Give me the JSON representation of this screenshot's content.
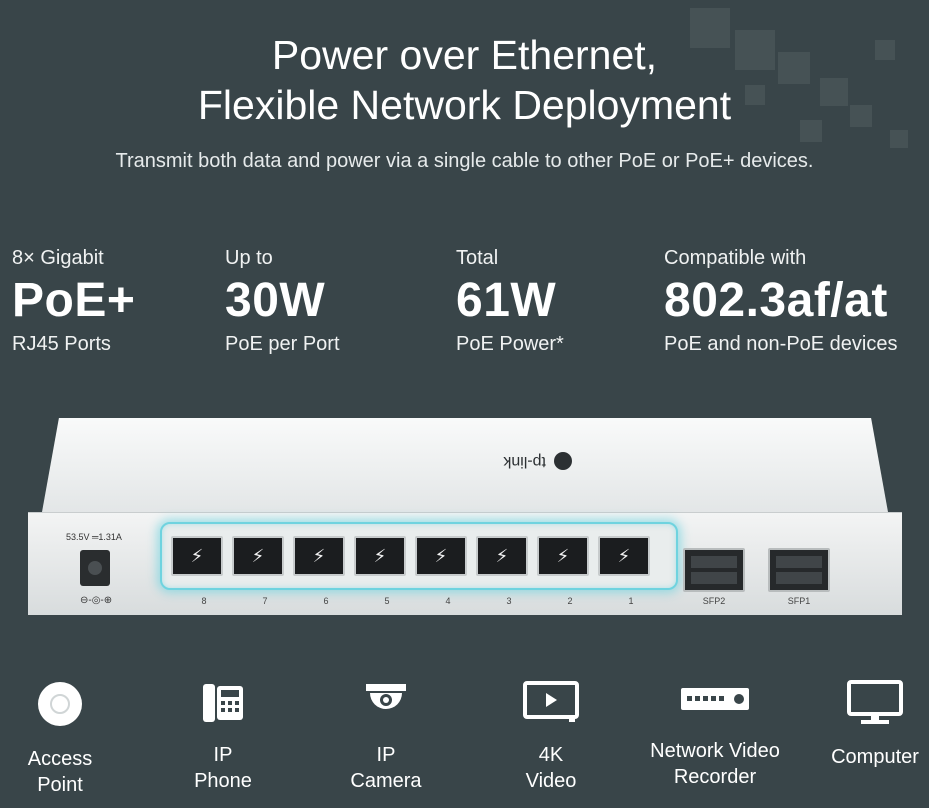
{
  "headline": {
    "line1": "Power over Ethernet,",
    "line2": "Flexible Network Deployment"
  },
  "subheadline": "Transmit both data and power via a single cable to other PoE or PoE+ devices.",
  "specs": [
    {
      "top": "8× Gigabit",
      "value": "PoE+",
      "bottom": "RJ45 Ports"
    },
    {
      "top": "Up to",
      "value": "30W",
      "bottom": "PoE per Port"
    },
    {
      "top": "Total",
      "value": "61W",
      "bottom": "PoE Power*"
    },
    {
      "top": "Compatible with",
      "value": "802.3af/at",
      "bottom": "PoE and non-PoE devices"
    }
  ],
  "switch": {
    "brand": "tp-link",
    "power_rating": "53.5V ═1.31A",
    "polarity_symbol": "⊖-◎-⊕",
    "poe_port_glyph": "⚡",
    "ports": [
      "8",
      "7",
      "6",
      "5",
      "4",
      "3",
      "2",
      "1"
    ],
    "sfp_ports": [
      "SFP2",
      "SFP1"
    ],
    "glow_color": "#6fd3df"
  },
  "devices": [
    {
      "label": "Access\nPoint",
      "icon": "access-point-icon"
    },
    {
      "label": "IP\nPhone",
      "icon": "ip-phone-icon"
    },
    {
      "label": "IP\nCamera",
      "icon": "ip-camera-icon"
    },
    {
      "label": "4K\nVideo",
      "icon": "video-player-icon"
    },
    {
      "label": "Network  Video\nRecorder",
      "icon": "video-recorder-icon"
    },
    {
      "label": "Computer",
      "icon": "computer-monitor-icon"
    }
  ],
  "colors": {
    "background": "#394549",
    "text": "#ffffff"
  }
}
